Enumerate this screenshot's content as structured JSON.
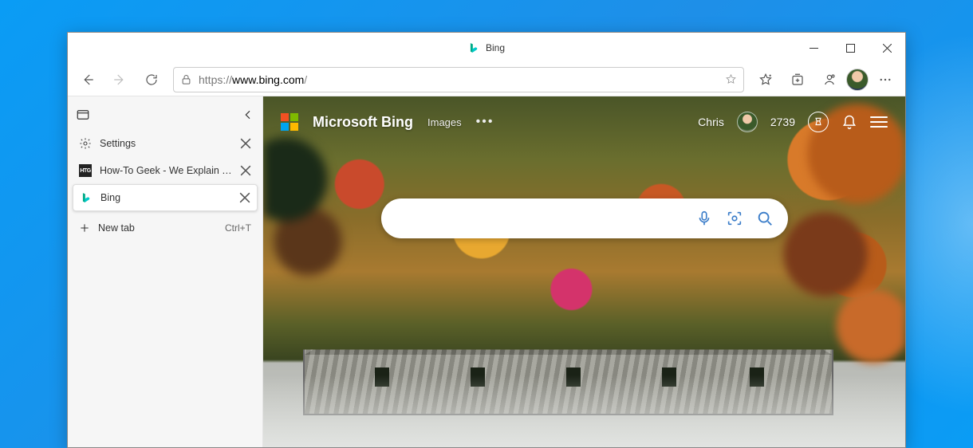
{
  "titlebar": {
    "title": "Bing"
  },
  "toolbar": {
    "url_proto": "https://",
    "url_host": "www.bing.com",
    "url_path": "/"
  },
  "sidebar": {
    "tabs": [
      {
        "label": "Settings"
      },
      {
        "label": "How-To Geek - We Explain Technology"
      },
      {
        "label": "Bing"
      }
    ],
    "newtab_label": "New tab",
    "newtab_shortcut": "Ctrl+T"
  },
  "bing": {
    "brand": "Microsoft Bing",
    "nav_images": "Images",
    "username": "Chris",
    "points": "2739",
    "search_placeholder": ""
  }
}
